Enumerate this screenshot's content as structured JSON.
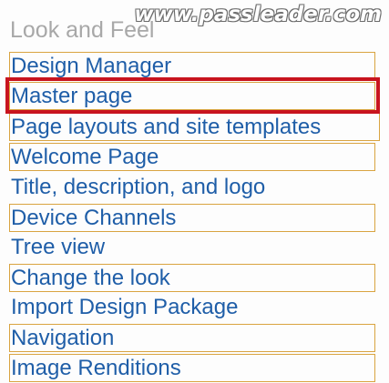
{
  "watermark": "www.passleader.com",
  "section": {
    "title": "Look and Feel"
  },
  "links": [
    "Design Manager",
    "Master page",
    "Page layouts and site templates",
    "Welcome Page",
    "Title, description, and logo",
    "Device Channels",
    "Tree view",
    "Change the look",
    "Import Design Package",
    "Navigation",
    "Image Renditions"
  ],
  "colors": {
    "link": "#1f5ea8",
    "heading": "#a8a8a8",
    "link_box_border": "#d9a441",
    "highlight_box": "#c8141e"
  }
}
